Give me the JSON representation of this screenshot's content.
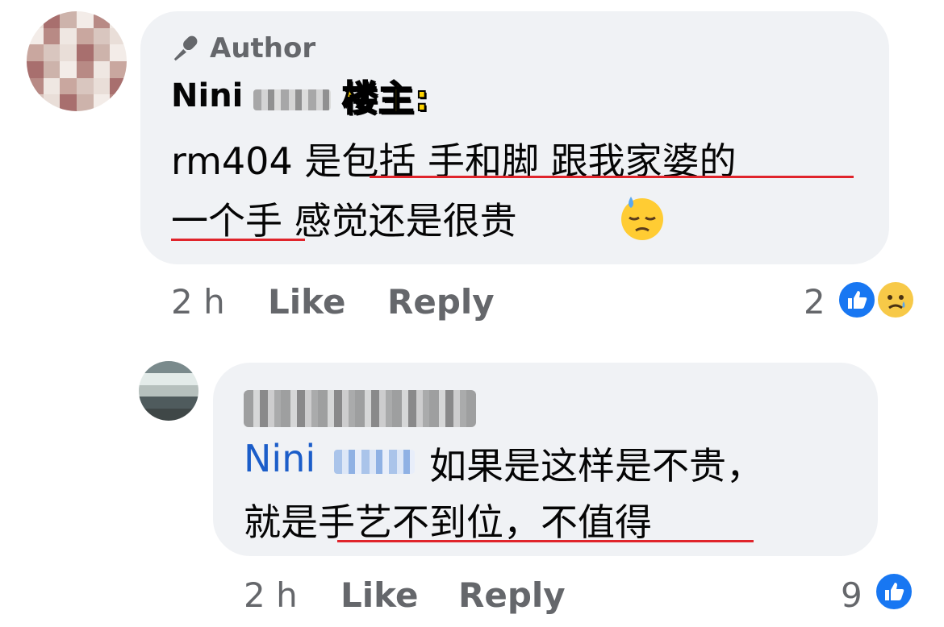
{
  "comment1": {
    "author_badge": "Author",
    "author_name": "Nini",
    "tag": "楼主:",
    "text_line1_a": "rm404 是",
    "text_line1_b": "包括 手和脚 跟我家婆的",
    "text_line2_a": "一个手",
    "text_line2_b": " 感觉还是很贵",
    "emoji": "downcast-face-with-sweat",
    "time": "2 h",
    "like_label": "Like",
    "reply_label": "Reply",
    "reaction_count": "2",
    "reactions": [
      "like",
      "sad"
    ]
  },
  "comment2": {
    "mention": "Nini",
    "text_line1": " 如果是这样是不贵，",
    "text_line2_a": "就是",
    "text_line2_b": "手艺不到位，不值得",
    "time": "2 h",
    "like_label": "Like",
    "reply_label": "Reply",
    "reaction_count": "9",
    "reactions": [
      "like"
    ]
  },
  "colors": {
    "bubble": "#f0f2f5",
    "meta_text": "#65676b",
    "mention": "#1b5dc9",
    "underline": "#e0242b",
    "tag_fill": "#ffd400",
    "like_blue": "#1877f2"
  }
}
